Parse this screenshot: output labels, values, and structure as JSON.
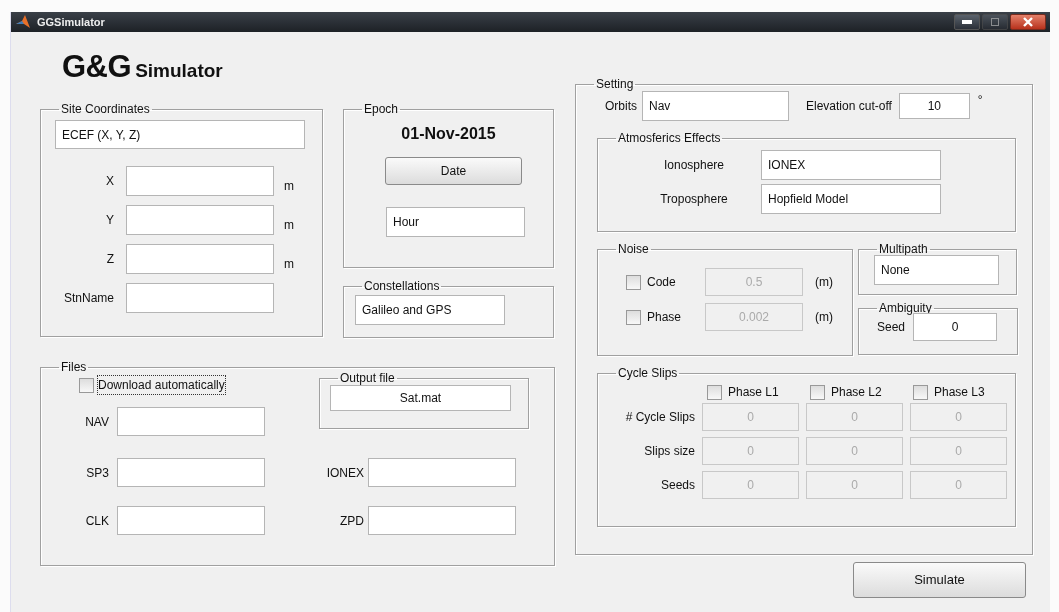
{
  "window": {
    "title": "GGSimulator"
  },
  "logo": {
    "main": "G&G",
    "sub": "Simulator"
  },
  "site_coordinates": {
    "title": "Site Coordinates",
    "system": "ECEF (X, Y, Z)",
    "fields": [
      {
        "label": "X",
        "unit": "m"
      },
      {
        "label": "Y",
        "unit": "m"
      },
      {
        "label": "Z",
        "unit": "m"
      },
      {
        "label": "StnName"
      }
    ]
  },
  "epoch": {
    "title": "Epoch",
    "date": "01-Nov-2015",
    "button": "Date",
    "hour": "Hour"
  },
  "constellations": {
    "title": "Constellations",
    "value": "Galileo and GPS"
  },
  "files": {
    "title": "Files",
    "download": {
      "label": "Download automatically",
      "checked": false,
      "focused": true
    },
    "output": {
      "title": "Output file",
      "value": "Sat.mat"
    },
    "left_fields": [
      {
        "label": "NAV"
      },
      {
        "label": "SP3"
      },
      {
        "label": "CLK"
      }
    ],
    "right_fields": [
      {
        "label": "IONEX"
      },
      {
        "label": "ZPD"
      }
    ]
  },
  "setting": {
    "title": "Setting",
    "orbits": {
      "label": "Orbits",
      "value": "Nav"
    },
    "elevation": {
      "label": "Elevation cut-off",
      "value": "10",
      "unit": "°"
    },
    "atmospherics": {
      "title": "Atmosferics Effects",
      "rows": [
        {
          "label": "Ionosphere",
          "value": "IONEX"
        },
        {
          "label": "Troposphere",
          "value": "Hopfield Model"
        }
      ]
    },
    "noise": {
      "title": "Noise",
      "rows": [
        {
          "label": "Code",
          "checked": false,
          "value": "0.5",
          "disabled": true,
          "unit": "(m)"
        },
        {
          "label": "Phase",
          "checked": false,
          "value": "0.002",
          "disabled": true,
          "unit": "(m)"
        }
      ]
    },
    "multipath": {
      "title": "Multipath",
      "value": "None"
    },
    "ambiguity": {
      "title": "Ambiguity",
      "label": "Seed",
      "value": "0"
    },
    "cycle_slips": {
      "title": "Cycle Slips",
      "phases": [
        {
          "label": "Phase L1",
          "checked": false
        },
        {
          "label": "Phase L2",
          "checked": false
        },
        {
          "label": "Phase L3",
          "checked": false
        }
      ],
      "rows": [
        {
          "label": "# Cycle Slips",
          "values": [
            "0",
            "0",
            "0"
          ],
          "disabled": true
        },
        {
          "label": "Slips size",
          "values": [
            "0",
            "0",
            "0"
          ],
          "disabled": true
        },
        {
          "label": "Seeds",
          "values": [
            "0",
            "0",
            "0"
          ],
          "disabled": true
        }
      ]
    }
  },
  "simulate_button": "Simulate"
}
